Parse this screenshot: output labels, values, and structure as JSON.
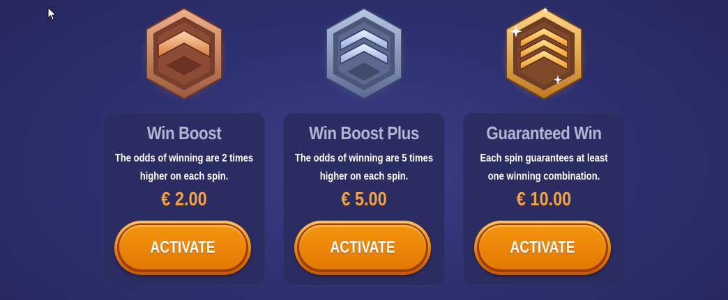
{
  "offers": [
    {
      "title": "Win Boost",
      "description": "The odds of winning are 2 times higher on each spin.",
      "price": "€ 2.00",
      "button_label": "ACTIVATE",
      "badge": "bronze-rank-badge-icon",
      "badge_color": "#c57a58"
    },
    {
      "title": "Win Boost Plus",
      "description": "The odds of winning are 5 times higher on each spin.",
      "price": "€ 5.00",
      "button_label": "ACTIVATE",
      "badge": "silver-rank-badge-icon",
      "badge_color": "#7f90b8"
    },
    {
      "title": "Guaranteed Win",
      "description": "Each spin guarantees at least one winning combination.",
      "price": "€ 10.00",
      "button_label": "ACTIVATE",
      "badge": "gold-rank-badge-icon",
      "badge_color": "#f2a23a"
    }
  ],
  "colors": {
    "background": "#2e3171",
    "card": "#2b2c62",
    "title": "#b3b6d1",
    "price": "#f3a33c",
    "button": "#ee8808"
  }
}
